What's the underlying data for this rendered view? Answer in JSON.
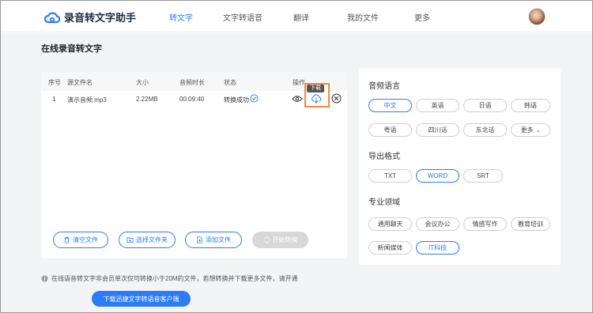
{
  "app": {
    "name": "录音转文字助手"
  },
  "nav": {
    "items": [
      "转文字",
      "文字转语音",
      "翻译",
      "我的文件",
      "更多"
    ],
    "active_index": 0
  },
  "page": {
    "title": "在线录音转文字"
  },
  "file_table": {
    "headers": [
      "序号",
      "源文件名",
      "大小",
      "音频时长",
      "状态",
      "操作"
    ],
    "rows": [
      {
        "index": "1",
        "name": "演示音频.mp3",
        "size": "2.22MB",
        "duration": "00:09:40",
        "status": "转换成功"
      }
    ],
    "download_tooltip": "下载"
  },
  "actions": {
    "clear": "清空文件",
    "choose_folder": "选择文件夹",
    "add_file": "添加文件",
    "start": "开始转换"
  },
  "audio_language": {
    "title": "音频语言",
    "options": [
      "中文",
      "英语",
      "日语",
      "韩语",
      "粤语",
      "四川话",
      "东北话",
      "更多"
    ],
    "selected": "中文"
  },
  "export_format": {
    "title": "导出格式",
    "options": [
      "TXT",
      "WORD",
      "SRT"
    ],
    "selected": "WORD"
  },
  "domain": {
    "title": "专业领域",
    "options": [
      "通用聊天",
      "会议办公",
      "情感写作",
      "教育培训",
      "新闻媒体",
      "IT科技"
    ],
    "selected": "IT科技"
  },
  "footer": {
    "note": "在线语音转文字非会员单次仅可转换小于20M的文件，若想转换并下载更多文件，请开通",
    "cta": "下载迅捷文字转语音客户端"
  },
  "colors": {
    "accent": "#2b7cf6",
    "highlight": "#f08a3c",
    "disabled": "#d8d8da"
  }
}
